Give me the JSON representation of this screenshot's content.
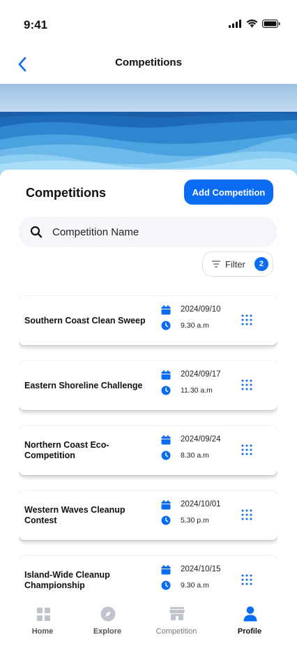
{
  "status_bar": {
    "time": "9:41"
  },
  "header": {
    "title": "Competitions",
    "back_icon": "chevron-left-icon"
  },
  "section": {
    "title": "Competitions",
    "add_button_label": "Add Competition"
  },
  "search": {
    "placeholder": "Competition Name",
    "value": "",
    "icon": "search-icon"
  },
  "filter": {
    "label": "Filter",
    "count": "2",
    "icon": "filter-icon"
  },
  "competitions": [
    {
      "name": "Southern Coast Clean Sweep",
      "date": "2024/09/10",
      "time": "9.30 a.m"
    },
    {
      "name": "Eastern Shoreline Challenge",
      "date": "2024/09/17",
      "time": "11.30 a.m"
    },
    {
      "name": "Northern Coast Eco-Competition",
      "date": "2024/09/24",
      "time": "8.30 a.m"
    },
    {
      "name": "Western Waves Cleanup Contest",
      "date": "2024/10/01",
      "time": "5.30 p.m"
    },
    {
      "name": "Island-Wide Cleanup Championship",
      "date": "2024/10/15",
      "time": "9.30 a.m"
    }
  ],
  "tabs": [
    {
      "label": "Home",
      "icon": "grid-icon",
      "active": false
    },
    {
      "label": "Explore",
      "icon": "compass-icon",
      "active": false
    },
    {
      "label": "Competition",
      "icon": "store-icon",
      "active": false
    },
    {
      "label": "Profile",
      "icon": "user-icon",
      "active": true
    }
  ],
  "colors": {
    "accent": "#0a6cf2",
    "tab_inactive": "#bfc3cc",
    "tab_active": "#0a6cf2",
    "banner_sky": "#a9c8e6",
    "banner_sea": "#1f6cb3"
  }
}
